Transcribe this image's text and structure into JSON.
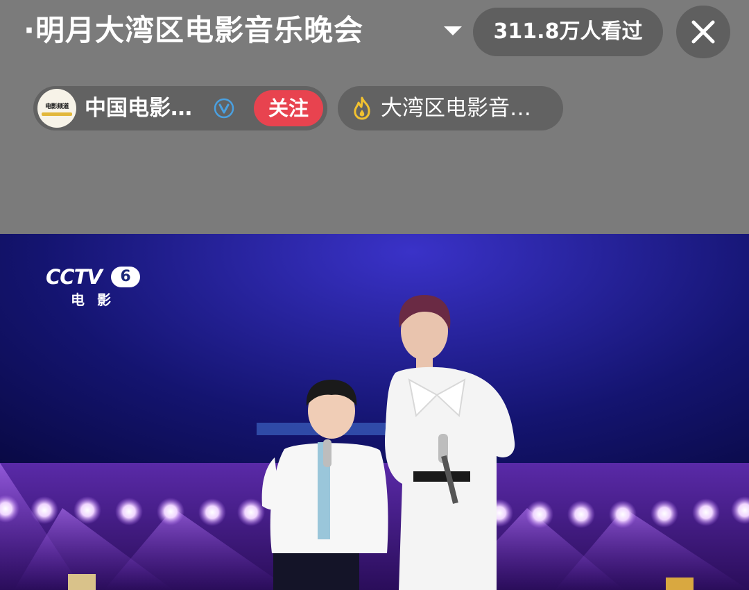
{
  "header": {
    "title": "·明月大湾区电影音乐晚会",
    "viewers": "311.8万人看过"
  },
  "channel": {
    "name": "中国电影…",
    "follow_label": "关注",
    "avatar_text": "电影频道"
  },
  "topic": {
    "label": "大湾区电影音…"
  },
  "video": {
    "logo_main": "CCTV",
    "logo_number": "6",
    "logo_sub": "电影"
  },
  "icons": {
    "title_dropdown": "chevron-down-icon",
    "close": "close-icon",
    "verified": "verified-badge-icon",
    "topic": "fire-icon"
  },
  "colors": {
    "follow_button": "#e8434f",
    "fire": "#f2c230",
    "verified": "#4aa0e0",
    "stage_background": "#0a0a4a",
    "stage_lights": "#c89af5"
  }
}
